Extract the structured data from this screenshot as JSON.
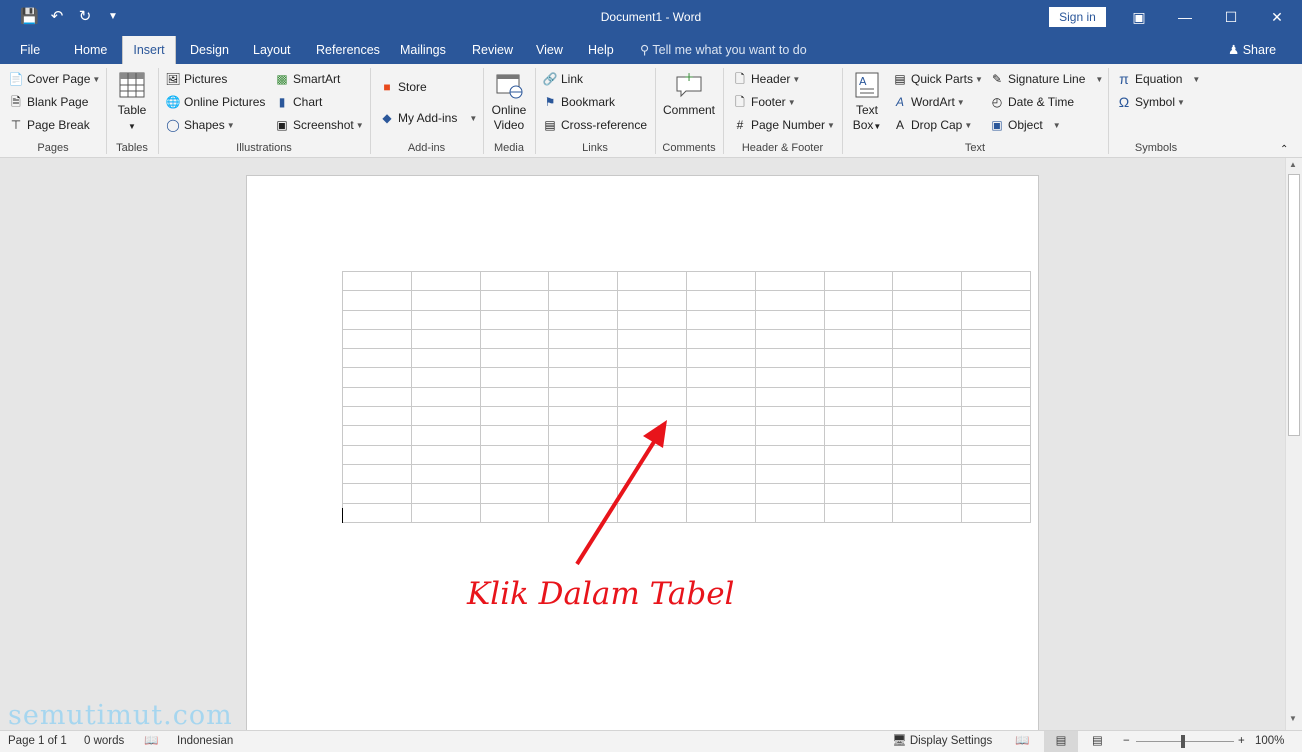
{
  "titlebar": {
    "title": "Document1 - Word",
    "sign_in": "Sign in",
    "qat_icons": [
      "save-icon",
      "undo-icon",
      "redo-icon",
      "customize-qat-icon"
    ],
    "window_icons": [
      "ribbon-display-icon",
      "minimize-icon",
      "maximize-icon",
      "close-icon"
    ]
  },
  "tabs": [
    {
      "label": "File"
    },
    {
      "label": "Home"
    },
    {
      "label": "Insert",
      "active": true
    },
    {
      "label": "Design"
    },
    {
      "label": "Layout"
    },
    {
      "label": "References"
    },
    {
      "label": "Mailings"
    },
    {
      "label": "Review"
    },
    {
      "label": "View"
    },
    {
      "label": "Help"
    }
  ],
  "tell_me": "Tell me what you want to do",
  "share": "Share",
  "ribbon": {
    "pages": {
      "label": "Pages",
      "items": [
        "Cover Page",
        "Blank Page",
        "Page Break"
      ]
    },
    "tables": {
      "label": "Tables",
      "table": "Table"
    },
    "illustrations": {
      "label": "Illustrations",
      "items": [
        "Pictures",
        "Online Pictures",
        "Shapes",
        "SmartArt",
        "Chart",
        "Screenshot"
      ]
    },
    "addins": {
      "label": "Add-ins",
      "items": [
        "Store",
        "My Add-ins"
      ]
    },
    "media": {
      "label": "Media",
      "online": "Online",
      "video": "Video"
    },
    "links": {
      "label": "Links",
      "items": [
        "Link",
        "Bookmark",
        "Cross-reference"
      ]
    },
    "comments": {
      "label": "Comments",
      "comment": "Comment"
    },
    "header_footer": {
      "label": "Header & Footer",
      "items": [
        "Header",
        "Footer",
        "Page Number"
      ]
    },
    "text": {
      "label": "Text",
      "text": "Text",
      "box": "Box",
      "items": [
        "Quick Parts",
        "WordArt",
        "Drop Cap",
        "Signature Line",
        "Date & Time",
        "Object"
      ]
    },
    "symbols": {
      "label": "Symbols",
      "items": [
        "Equation",
        "Symbol"
      ]
    }
  },
  "document": {
    "table": {
      "rows": 13,
      "cols": 10
    },
    "annotation": "Klik Dalam Tabel",
    "annotation_color": "#e8141b"
  },
  "status": {
    "page": "Page 1 of 1",
    "words": "0 words",
    "language": "Indonesian",
    "display_settings": "Display Settings",
    "zoom": "100%",
    "zoom_level": 100
  },
  "watermark": "semutimut.com",
  "colors": {
    "accent": "#2b579a",
    "ribbon": "#f3f3f3",
    "annotation": "#e8141b"
  }
}
